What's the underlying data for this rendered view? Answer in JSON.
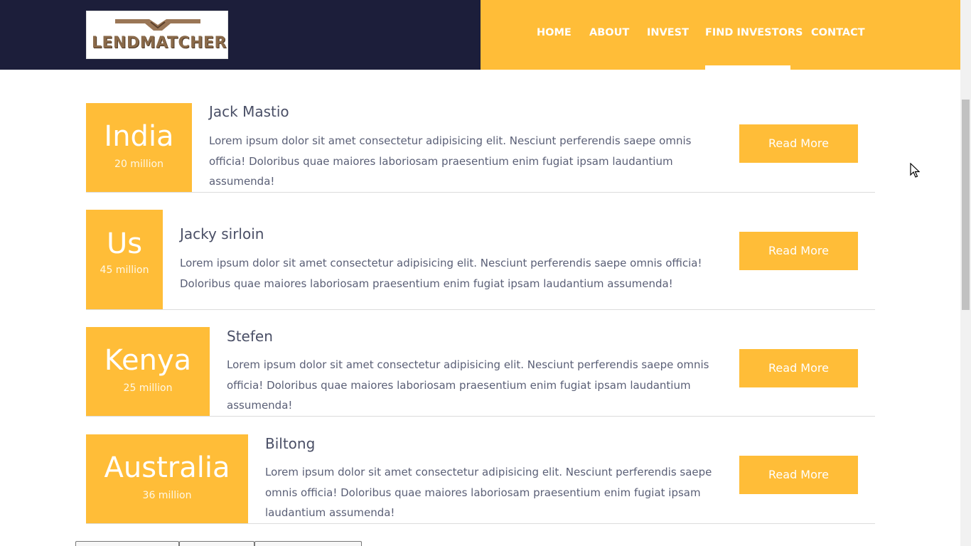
{
  "brand": {
    "logo_text": "LENDMATCHER"
  },
  "nav": {
    "items": [
      {
        "label": "HOME"
      },
      {
        "label": "ABOUT"
      },
      {
        "label": "INVEST"
      },
      {
        "label": "FIND INVESTORS"
      },
      {
        "label": "CONTACT"
      }
    ],
    "active": "FIND INVESTORS"
  },
  "investors": [
    {
      "country": "India",
      "population": "20 million",
      "name": "Jack Mastio",
      "description": "Lorem ipsum dolor sit amet consectetur adipisicing elit. Nesciunt perferendis saepe omnis officia! Doloribus quae maiores laboriosam praesentium enim fugiat ipsam laudantium assumenda!",
      "button": "Read More"
    },
    {
      "country": "Us",
      "population": "45 million",
      "name": "Jacky sirloin",
      "description": "Lorem ipsum dolor sit amet consectetur adipisicing elit. Nesciunt perferendis saepe omnis officia! Doloribus quae maiores laboriosam praesentium enim fugiat ipsam laudantium assumenda!",
      "button": "Read More"
    },
    {
      "country": "Kenya",
      "population": "25 million",
      "name": "Stefen",
      "description": "Lorem ipsum dolor sit amet consectetur adipisicing elit. Nesciunt perferendis saepe omnis officia! Doloribus quae maiores laboriosam praesentium enim fugiat ipsam laudantium assumenda!",
      "button": "Read More"
    },
    {
      "country": "Australia",
      "population": "36 million",
      "name": "Biltong",
      "description": "Lorem ipsum dolor sit amet consectetur adipisicing elit. Nesciunt perferendis saepe omnis officia! Doloribus quae maiores laboriosam praesentium enim fugiat ipsam laudantium assumenda!",
      "button": "Read More"
    }
  ],
  "colors": {
    "header_dark": "#1c1e3a",
    "accent": "#ffbd38",
    "text": "#555a70"
  }
}
